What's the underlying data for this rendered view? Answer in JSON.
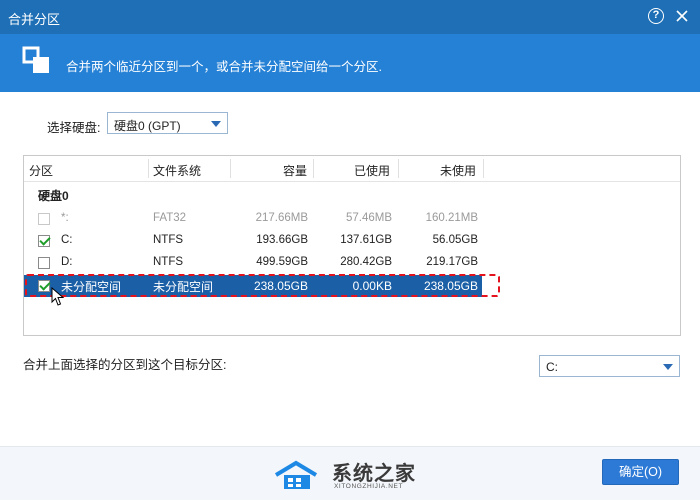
{
  "window": {
    "title": "合并分区",
    "help_label": "?"
  },
  "banner": {
    "text": "合并两个临近分区到一个，或合并未分配空间给一个分区."
  },
  "disk_select": {
    "label": "选择硬盘:",
    "value": "硬盘0 (GPT)"
  },
  "table": {
    "columns": [
      "分区",
      "文件系统",
      "容量",
      "已使用",
      "未使用"
    ],
    "group": "硬盘0",
    "rows": [
      {
        "checked": false,
        "enabled": false,
        "partition": "*:",
        "fs": "FAT32",
        "capacity": "217.66MB",
        "used": "57.46MB",
        "unused": "160.21MB"
      },
      {
        "checked": true,
        "enabled": true,
        "partition": "C:",
        "fs": "NTFS",
        "capacity": "193.66GB",
        "used": "137.61GB",
        "unused": "56.05GB"
      },
      {
        "checked": false,
        "enabled": true,
        "partition": "D:",
        "fs": "NTFS",
        "capacity": "499.59GB",
        "used": "280.42GB",
        "unused": "219.17GB"
      },
      {
        "checked": true,
        "enabled": true,
        "selected": true,
        "partition": "未分配空间",
        "fs": "未分配空间",
        "capacity": "238.05GB",
        "used": "0.00KB",
        "unused": "238.05GB"
      }
    ]
  },
  "target": {
    "label": "合并上面选择的分区到这个目标分区:",
    "value": "C:"
  },
  "watermark": {
    "name": "系统之家",
    "url": "XITONGZHIJIA.NET"
  },
  "footer": {
    "ok_label": "确定(O)"
  },
  "colors": {
    "titlebar": "#1e6fb5",
    "banner": "#2581d5",
    "selection": "#1b5fa6",
    "check": "#1f9d2a",
    "highlight": "#e3121c"
  }
}
